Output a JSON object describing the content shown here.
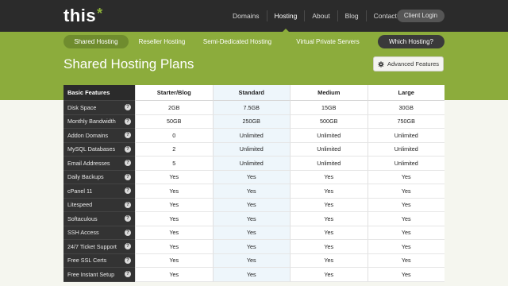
{
  "brand": {
    "logo_text": "this",
    "logo_star": "*"
  },
  "topnav": {
    "items": [
      {
        "label": "Domains"
      },
      {
        "label": "Hosting"
      },
      {
        "label": "About"
      },
      {
        "label": "Blog"
      },
      {
        "label": "Contact"
      }
    ],
    "active": "Hosting",
    "client_login": "Client Login"
  },
  "subnav": {
    "items": [
      {
        "label": "Shared Hosting"
      },
      {
        "label": "Reseller Hosting"
      },
      {
        "label": "Semi-Dedicated Hosting"
      },
      {
        "label": "Virtual Private Servers"
      },
      {
        "label": "Which Hosting?"
      }
    ],
    "active": "Shared Hosting"
  },
  "page": {
    "title": "Shared Hosting Plans",
    "advanced_button": "Advanced Features",
    "advanced_icon": "gear-icon"
  },
  "table": {
    "corner_header": "Basic Features",
    "plans": [
      "Starter/Blog",
      "Standard",
      "Medium",
      "Large"
    ],
    "highlighted_plan": "Standard",
    "help_glyph": "?",
    "rows": [
      {
        "feature": "Disk Space",
        "values": [
          "2GB",
          "7.5GB",
          "15GB",
          "30GB"
        ]
      },
      {
        "feature": "Monthly Bandwidth",
        "values": [
          "50GB",
          "250GB",
          "500GB",
          "750GB"
        ]
      },
      {
        "feature": "Addon Domains",
        "values": [
          "0",
          "Unlimited",
          "Unlimited",
          "Unlimited"
        ]
      },
      {
        "feature": "MySQL Databases",
        "values": [
          "2",
          "Unlimited",
          "Unlimited",
          "Unlimited"
        ]
      },
      {
        "feature": "Email Addresses",
        "values": [
          "5",
          "Unlimited",
          "Unlimited",
          "Unlimited"
        ]
      },
      {
        "feature": "Daily Backups",
        "values": [
          "Yes",
          "Yes",
          "Yes",
          "Yes"
        ]
      },
      {
        "feature": "cPanel 11",
        "values": [
          "Yes",
          "Yes",
          "Yes",
          "Yes"
        ]
      },
      {
        "feature": "Litespeed",
        "values": [
          "Yes",
          "Yes",
          "Yes",
          "Yes"
        ]
      },
      {
        "feature": "Softaculous",
        "values": [
          "Yes",
          "Yes",
          "Yes",
          "Yes"
        ]
      },
      {
        "feature": "SSH Access",
        "values": [
          "Yes",
          "Yes",
          "Yes",
          "Yes"
        ]
      },
      {
        "feature": "24/7 Ticket Support",
        "values": [
          "Yes",
          "Yes",
          "Yes",
          "Yes"
        ]
      },
      {
        "feature": "Free SSL Certs",
        "values": [
          "Yes",
          "Yes",
          "Yes",
          "Yes"
        ]
      },
      {
        "feature": "Free Instant Setup",
        "values": [
          "Yes",
          "Yes",
          "Yes",
          "Yes"
        ]
      }
    ]
  },
  "colors": {
    "topbar": "#2b2b2b",
    "accent_green": "#8cac3c",
    "sidebar": "#333333",
    "highlight_column": "#eef6fb",
    "background": "#f5f6ef"
  }
}
